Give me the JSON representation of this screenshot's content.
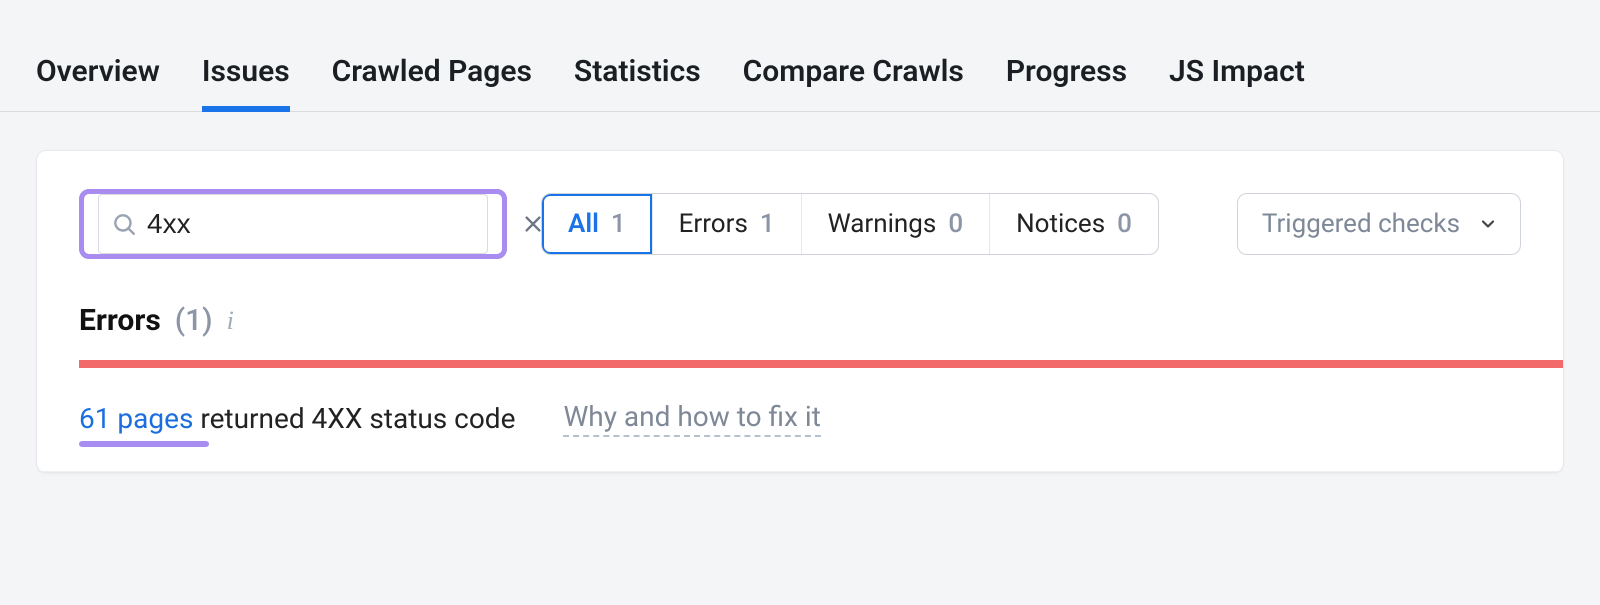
{
  "tabs": {
    "items": [
      {
        "label": "Overview",
        "active": false
      },
      {
        "label": "Issues",
        "active": true
      },
      {
        "label": "Crawled Pages",
        "active": false
      },
      {
        "label": "Statistics",
        "active": false
      },
      {
        "label": "Compare Crawls",
        "active": false
      },
      {
        "label": "Progress",
        "active": false
      },
      {
        "label": "JS Impact",
        "active": false
      }
    ]
  },
  "search": {
    "value": "4xx",
    "placeholder": ""
  },
  "filters": {
    "items": [
      {
        "label": "All",
        "count": "1",
        "active": true
      },
      {
        "label": "Errors",
        "count": "1",
        "active": false
      },
      {
        "label": "Warnings",
        "count": "0",
        "active": false
      },
      {
        "label": "Notices",
        "count": "0",
        "active": false
      }
    ]
  },
  "dropdown": {
    "label": "Triggered checks"
  },
  "section": {
    "title": "Errors",
    "count": "(1)"
  },
  "issue": {
    "link_text": "61 pages",
    "rest_text": " returned 4XX status code",
    "fix_text": "Why and how to fix it"
  }
}
